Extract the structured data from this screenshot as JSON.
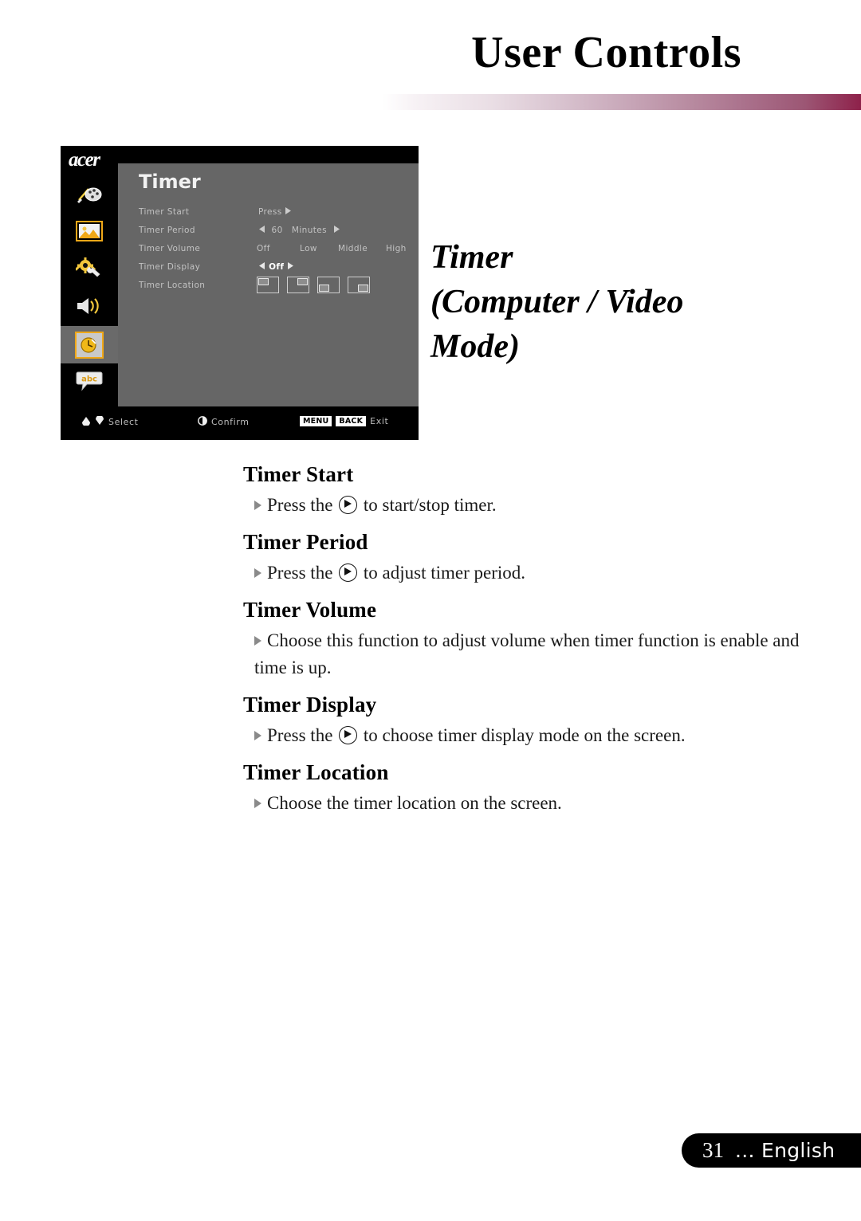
{
  "header": {
    "title": "User Controls",
    "brand": "acer"
  },
  "osd": {
    "brand": "acer",
    "title": "Timer",
    "sidebar": [
      {
        "icon": "color-palette-icon",
        "label": "Color",
        "selected": false
      },
      {
        "icon": "image-icon",
        "label": "Image",
        "selected": false
      },
      {
        "icon": "gear-wrench-icon",
        "label": "Setting",
        "selected": false
      },
      {
        "icon": "speaker-volume-icon",
        "label": "Audio",
        "selected": false
      },
      {
        "icon": "clock-timer-icon",
        "label": "Timer",
        "selected": true
      },
      {
        "icon": "speech-bubble-abc-icon",
        "label": "Language",
        "selected": false
      }
    ],
    "rows": [
      {
        "label": "Timer Start",
        "value": "Press"
      },
      {
        "label": "Timer Period",
        "value": "60",
        "unit": "Minutes"
      },
      {
        "label": "Timer Volume",
        "options": [
          "Off",
          "Low",
          "Middle",
          "High"
        ]
      },
      {
        "label": "Timer Display",
        "value": "Off"
      },
      {
        "label": "Timer Location",
        "icons": [
          "top-left",
          "top-right",
          "bottom-left",
          "bottom-right"
        ]
      }
    ],
    "bottom_bar": {
      "select_label": "Select",
      "confirm_label": "Confirm",
      "key_menu": "MENU",
      "key_back": "BACK",
      "exit_label": "Exit"
    }
  },
  "section": {
    "title_line1": "Timer",
    "title_line2": "(Computer / Video",
    "title_line3": "Mode)"
  },
  "body_sections": [
    {
      "heading": "Timer Start",
      "text_before": "Press the",
      "has_button_icon": true,
      "text_after": "to start/stop timer."
    },
    {
      "heading": "Timer Period",
      "text_before": "Press the",
      "has_button_icon": true,
      "text_after": "to adjust timer period."
    },
    {
      "heading": "Timer Volume",
      "text_before": "Choose this function to adjust volume when timer function is enable and time is up.",
      "has_button_icon": false,
      "text_after": ""
    },
    {
      "heading": "Timer Display",
      "text_before": "Press the",
      "has_button_icon": true,
      "text_after": "to choose timer display mode on the screen."
    },
    {
      "heading": "Timer Location",
      "text_before": "Choose the timer location on the screen.",
      "has_button_icon": false,
      "text_after": ""
    }
  ],
  "footer": {
    "page_number": "31",
    "language": "... English"
  },
  "colors": {
    "brand_crimson": "#8e214a",
    "osd_gray": "#666666",
    "osd_black": "#000000",
    "highlight_orange": "#f0a818"
  }
}
